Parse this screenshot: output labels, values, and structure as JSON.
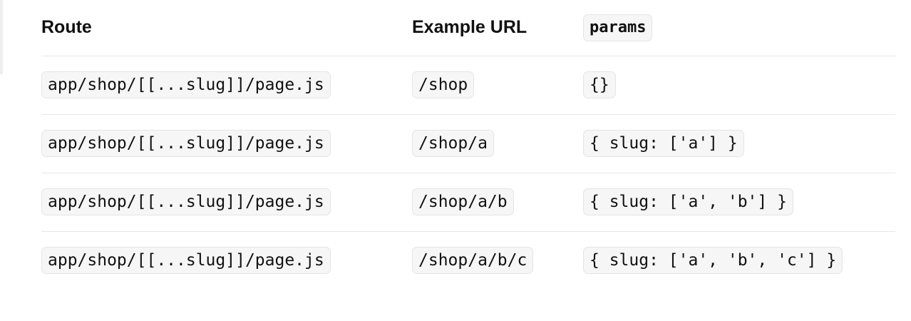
{
  "table": {
    "headers": {
      "route": "Route",
      "example_url": "Example URL",
      "params": "params"
    },
    "rows": [
      {
        "route": "app/shop/[[...slug]]/page.js",
        "url": "/shop",
        "params": "{}"
      },
      {
        "route": "app/shop/[[...slug]]/page.js",
        "url": "/shop/a",
        "params": "{ slug: ['a'] }"
      },
      {
        "route": "app/shop/[[...slug]]/page.js",
        "url": "/shop/a/b",
        "params": "{ slug: ['a', 'b'] }"
      },
      {
        "route": "app/shop/[[...slug]]/page.js",
        "url": "/shop/a/b/c",
        "params": "{ slug: ['a', 'b', 'c'] }"
      }
    ]
  },
  "colors": {
    "code_background": "#f6f6f6",
    "code_border": "#e5e5e5",
    "divider": "#e7e7e7",
    "text": "#111111"
  }
}
